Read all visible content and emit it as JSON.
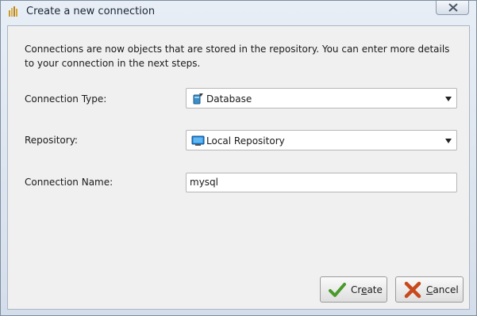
{
  "window": {
    "title": "Create a new connection"
  },
  "dialog": {
    "description": "Connections are now objects that are stored in the repository. You can enter more details to your connection in the next steps.",
    "fields": {
      "connection_type": {
        "label": "Connection Type:",
        "selected": "Database",
        "icon": "database-icon"
      },
      "repository": {
        "label": "Repository:",
        "selected": "Local Repository",
        "icon": "monitor-icon"
      },
      "connection_name": {
        "label": "Connection Name:",
        "value": "mysql"
      }
    },
    "buttons": {
      "create": {
        "pre": "Cr",
        "mnemonic": "e",
        "post": "ate",
        "icon": "checkmark-icon"
      },
      "cancel": {
        "pre": "",
        "mnemonic": "C",
        "post": "ancel",
        "icon": "cross-icon"
      }
    }
  },
  "colors": {
    "accent_green": "#4a9a2a",
    "accent_red": "#c8491c",
    "title_bg": "#dbe4ef"
  }
}
